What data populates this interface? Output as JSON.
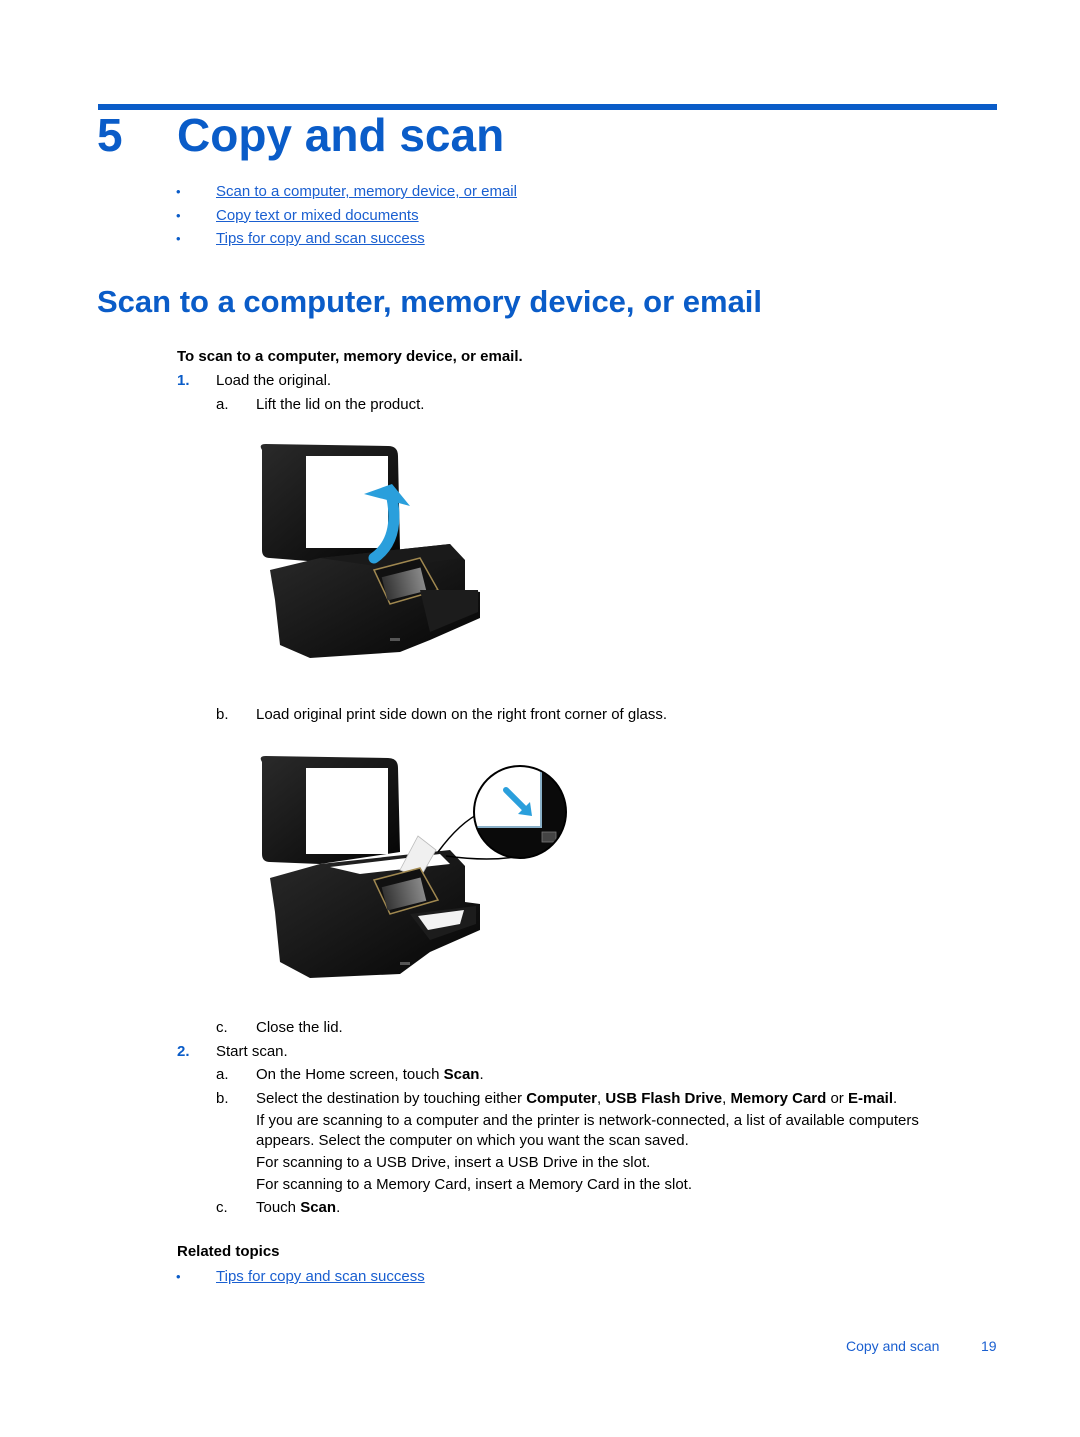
{
  "chapter": {
    "number": "5",
    "title": "Copy and scan"
  },
  "toc": [
    {
      "label": "Scan to a computer, memory device, or email"
    },
    {
      "label": "Copy text or mixed documents"
    },
    {
      "label": "Tips for copy and scan success"
    }
  ],
  "section": {
    "title": "Scan to a computer, memory device, or email",
    "procedure_title": "To scan to a computer, memory device, or email.",
    "steps": [
      {
        "marker": "1.",
        "text": "Load the original.",
        "substeps": [
          {
            "marker": "a.",
            "text": "Lift the lid on the product.",
            "figure": "printer-lid-open-figure"
          },
          {
            "marker": "b.",
            "text": "Load original print side down on the right front corner of glass.",
            "figure": "printer-glass-corner-figure"
          },
          {
            "marker": "c.",
            "text": "Close the lid."
          }
        ]
      },
      {
        "marker": "2.",
        "text": "Start scan.",
        "substeps": [
          {
            "marker": "a.",
            "text_before": "On the Home screen, touch ",
            "bold": "Scan",
            "text_after": "."
          },
          {
            "marker": "b.",
            "text_before": "Select the destination by touching either ",
            "bold1": "Computer",
            "sep1": ", ",
            "bold2": "USB Flash Drive",
            "sep2": ", ",
            "bold3": "Memory Card",
            "sep3": " or ",
            "bold4": "E-mail",
            "end": ".",
            "notes": [
              "If you are scanning to a computer and the printer is network-connected, a list of available computers",
              "appears. Select the computer on which you want the scan saved.",
              "For scanning to a USB Drive, insert a USB Drive in the slot.",
              "For scanning to a Memory Card, insert a Memory Card in the slot."
            ]
          },
          {
            "marker": "c.",
            "text_before": "Touch ",
            "bold": "Scan",
            "text_after": "."
          }
        ]
      }
    ]
  },
  "related": {
    "title": "Related topics",
    "links": [
      {
        "label": "Tips for copy and scan success"
      }
    ]
  },
  "footer": {
    "section": "Copy and scan",
    "page": "19"
  },
  "colors": {
    "accent": "#0a5cc8",
    "link": "#1a5fd0"
  }
}
